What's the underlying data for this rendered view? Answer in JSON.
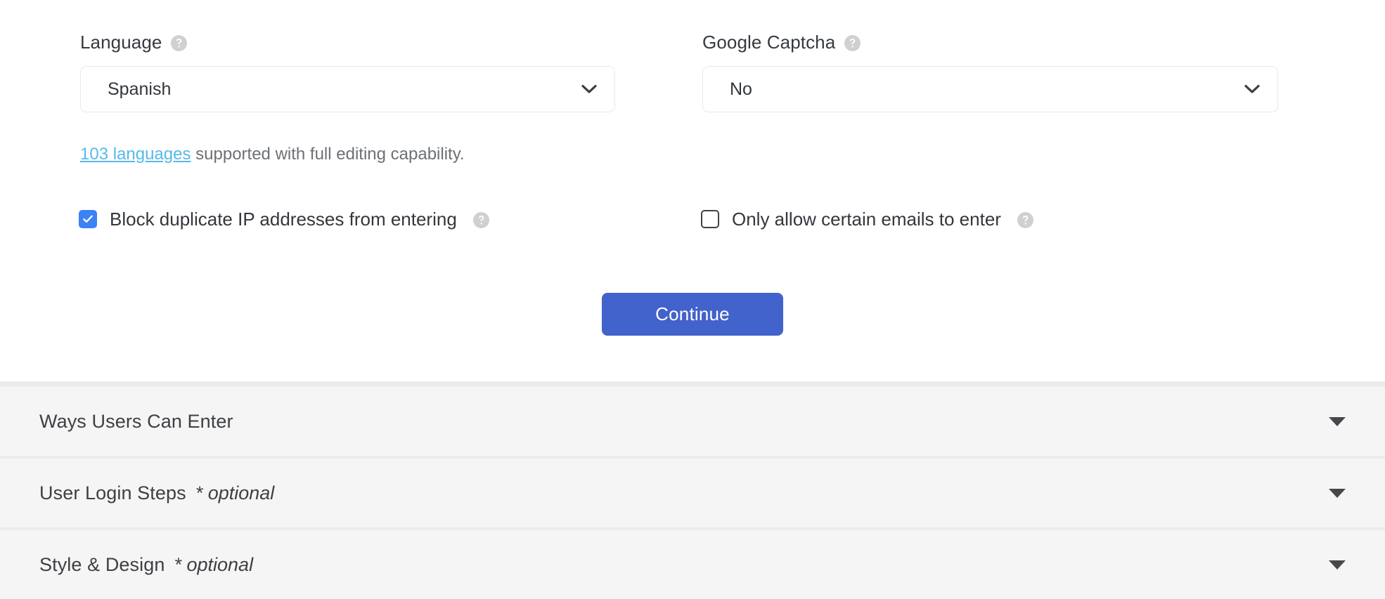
{
  "theme": {
    "page_bg": "#ffffff",
    "panel_bg": "#f5f5f5",
    "accent_button": "#4262cc",
    "link_blue": "#56b9e8",
    "checkbox_blue": "#3b82f6",
    "help_icon_gray": "#cfd0d2",
    "text_dark": "#33373c",
    "text_muted": "#6d7175",
    "border_gray": "#e8e9eb"
  },
  "form": {
    "language_field": {
      "label": "Language",
      "help_icon": "question-mark-circle-icon",
      "selected_value": "Spanish",
      "caret_icon": "chevron-down-icon"
    },
    "captcha_field": {
      "label": "Google Captcha",
      "help_icon": "question-mark-circle-icon",
      "selected_value": "No",
      "caret_icon": "chevron-down-icon"
    },
    "helper_text": {
      "link": "103 languages",
      "rest": " supported with full editing capability."
    },
    "checkboxes": [
      {
        "label": "Block duplicate IP addresses from entering",
        "checked": true,
        "help_icon": "question-mark-circle-icon"
      },
      {
        "label": "Only allow certain emails to enter",
        "checked": false,
        "help_icon": "question-mark-circle-icon"
      }
    ],
    "submit_button": "Continue"
  },
  "accordion": {
    "sections": [
      {
        "title": "Ways Users Can Enter",
        "optional": "",
        "caret_icon": "triangle-down-icon"
      },
      {
        "title": "User Login Steps",
        "optional": "* optional",
        "caret_icon": "triangle-down-icon"
      },
      {
        "title": "Style & Design",
        "optional": "* optional",
        "caret_icon": "triangle-down-icon"
      }
    ]
  }
}
